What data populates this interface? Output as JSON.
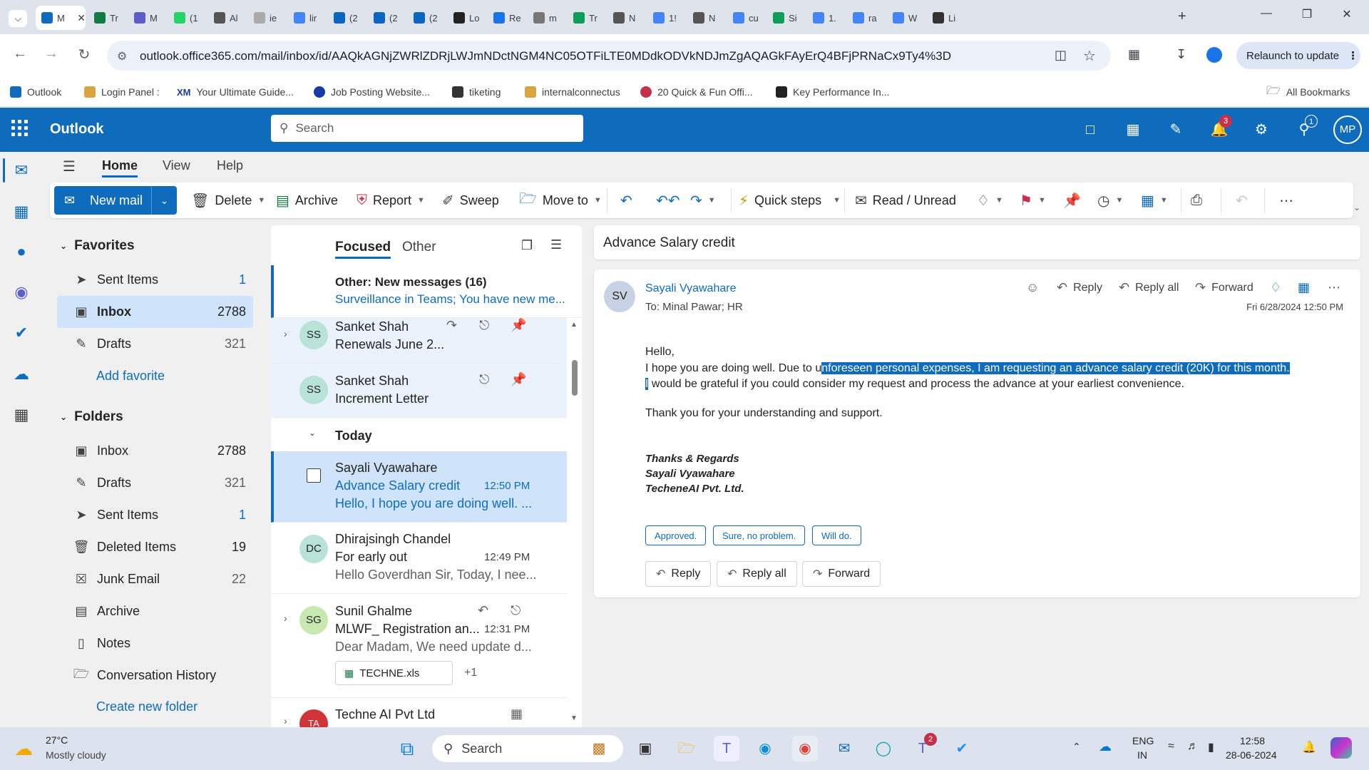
{
  "browser": {
    "tabs": [
      {
        "title": "M",
        "color": "#0f6cbd"
      },
      {
        "title": "Tr",
        "color": "#107c41"
      },
      {
        "title": "M",
        "color": "#5b5fc7"
      },
      {
        "title": "(1",
        "color": "#25d366"
      },
      {
        "title": "Al",
        "color": "#555555"
      },
      {
        "title": "ie",
        "color": "#aaaaaa"
      },
      {
        "title": "lir",
        "color": "#4285f4"
      },
      {
        "title": "(2",
        "color": "#0a66c2"
      },
      {
        "title": "(2",
        "color": "#0a66c2"
      },
      {
        "title": "(2",
        "color": "#0a66c2"
      },
      {
        "title": "Lo",
        "color": "#222222"
      },
      {
        "title": "Re",
        "color": "#1a73e8"
      },
      {
        "title": "m",
        "color": "#777777"
      },
      {
        "title": "Tr",
        "color": "#0f9d58"
      },
      {
        "title": "N",
        "color": "#555555"
      },
      {
        "title": "1!",
        "color": "#4285f4"
      },
      {
        "title": "N",
        "color": "#555555"
      },
      {
        "title": "cu",
        "color": "#4285f4"
      },
      {
        "title": "Si",
        "color": "#0f9d58"
      },
      {
        "title": "1.",
        "color": "#4285f4"
      },
      {
        "title": "ra",
        "color": "#4285f4"
      },
      {
        "title": "W",
        "color": "#4285f4"
      },
      {
        "title": "Li",
        "color": "#333333"
      }
    ],
    "url": "outlook.office365.com/mail/inbox/id/AAQkAGNjZWRlZDRjLWJmNDctNGM4NC05OTFiLTE0MDdkODVkNDJmZgAQAGkFAyErQ4BFjPRNaCx9Ty4%3D",
    "relaunch": "Relaunch to update",
    "bookmarks": [
      "Outlook",
      "Login Panel :",
      "Your Ultimate Guide...",
      "Job Posting Website...",
      "tiketing",
      "internalconnectus",
      "20 Quick & Fun Offi...",
      "Key Performance In..."
    ],
    "all_bookmarks": "All Bookmarks"
  },
  "outlook": {
    "app_name": "Outlook",
    "search_placeholder": "Search",
    "notif_badge": "3",
    "tips_badge": "1",
    "avatar": "MP",
    "menu": [
      "Home",
      "View",
      "Help"
    ],
    "ribbon": {
      "new_mail": "New mail",
      "delete": "Delete",
      "archive": "Archive",
      "report": "Report",
      "sweep": "Sweep",
      "move_to": "Move to",
      "quick_steps": "Quick steps",
      "read_unread": "Read / Unread"
    }
  },
  "folders": {
    "favorites_label": "Favorites",
    "favorites": [
      {
        "name": "Sent Items",
        "count": "1"
      },
      {
        "name": "Inbox",
        "count": "2788"
      },
      {
        "name": "Drafts",
        "count": "321"
      }
    ],
    "add_favorite": "Add favorite",
    "folders_label": "Folders",
    "items": [
      {
        "name": "Inbox",
        "count": "2788"
      },
      {
        "name": "Drafts",
        "count": "321"
      },
      {
        "name": "Sent Items",
        "count": "1"
      },
      {
        "name": "Deleted Items",
        "count": "19"
      },
      {
        "name": "Junk Email",
        "count": "22"
      },
      {
        "name": "Archive",
        "count": ""
      },
      {
        "name": "Notes",
        "count": ""
      },
      {
        "name": "Conversation History",
        "count": ""
      }
    ],
    "create_folder": "Create new folder"
  },
  "messages": {
    "tab_focused": "Focused",
    "tab_other": "Other",
    "other_banner_title": "Other: New messages (16)",
    "other_banner_sub": "Surveillance in Teams; You have new me...",
    "today": "Today",
    "list": [
      {
        "initials": "SS",
        "sender": "Sanket Shah",
        "subject": "Renewals June 2...",
        "preview": "",
        "time": ""
      },
      {
        "initials": "SS",
        "sender": "Sanket Shah",
        "subject": "Increment Letter",
        "preview": "",
        "time": ""
      },
      {
        "initials": "SV",
        "sender": "Sayali Vyawahare",
        "subject": "Advance Salary credit",
        "preview": "Hello, I hope you are doing well. ...",
        "time": "12:50 PM"
      },
      {
        "initials": "DC",
        "sender": "Dhirajsingh Chandel",
        "subject": "For early out",
        "preview": "Hello Goverdhan Sir, Today, I nee...",
        "time": "12:49 PM"
      },
      {
        "initials": "SG",
        "sender": "Sunil Ghalme",
        "subject": "MLWF_ Registration an...",
        "preview": "Dear Madam, We need update d...",
        "time": "12:31 PM",
        "attachment": "TECHNE.xls",
        "more": "+1"
      },
      {
        "initials": "TA",
        "sender": "Techne AI Pvt Ltd",
        "subject": "",
        "preview": "",
        "time": ""
      }
    ]
  },
  "reading": {
    "subject": "Advance Salary credit",
    "avatar": "SV",
    "from": "Sayali Vyawahare",
    "to": "To:  Minal Pawar;   HR",
    "date": "Fri 6/28/2024 12:50 PM",
    "reply": "Reply",
    "reply_all": "Reply all",
    "forward": "Forward",
    "greeting": "Hello,",
    "line1_pre": "I hope you are doing well. Due to u",
    "line1_hl": "nforeseen personal expenses, I am requesting an advance salary credit (20K) for this month.",
    "line2_hl": "I",
    "line2_post": " would be grateful if you could consider my request and process the advance at your earliest convenience.",
    "line3": "Thank you for your understanding and support.",
    "sig1": "Thanks & Regards",
    "sig2": "Sayali Vyawahare",
    "sig3": "TecheneAI Pvt. Ltd.",
    "suggestions": [
      "Approved.",
      "Sure, no problem.",
      "Will do."
    ]
  },
  "taskbar": {
    "temp": "27°C",
    "weather": "Mostly cloudy",
    "search": "Search",
    "teams_badge": "2",
    "lang1": "ENG",
    "lang2": "IN",
    "time": "12:58",
    "date": "28-06-2024"
  }
}
